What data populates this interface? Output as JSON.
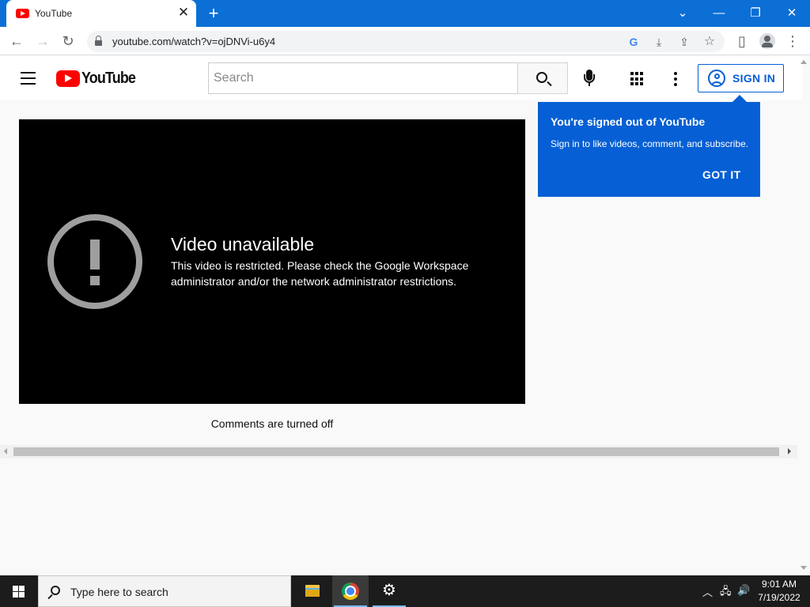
{
  "browser": {
    "tab_title": "YouTube",
    "tab_close": "✕",
    "new_tab": "+",
    "url": "youtube.com/watch?v=ojDNVi-u6y4",
    "window_controls": {
      "dropdown": "⌄",
      "minimize": "—",
      "restore": "❐",
      "close": "✕"
    },
    "nav": {
      "back": "←",
      "forward": "→",
      "reload": "↻"
    },
    "toolbar_icons": {
      "google": "G",
      "install": "⤓",
      "share": "⇪",
      "bookmark": "☆",
      "sidepanel": "▯",
      "menu": "⋮"
    }
  },
  "youtube": {
    "logo_text": "YouTube",
    "search_placeholder": "Search",
    "sign_in_label": "SIGN IN",
    "accent_color": "#065fd4",
    "brand_red": "#ff0000"
  },
  "player": {
    "error_title": "Video unavailable",
    "error_message": "This video is restricted. Please check the Google Workspace administrator and/or the network administrator restrictions."
  },
  "comments_status": "Comments are turned off",
  "tooltip": {
    "title": "You're signed out of YouTube",
    "body": "Sign in to like videos, comment, and subscribe.",
    "button": "GOT IT"
  },
  "taskbar": {
    "search_placeholder": "Type here to search",
    "time": "9:01 AM",
    "date": "7/19/2022",
    "tray": {
      "chevron": "︿",
      "network": "🖧",
      "volume": "🔊"
    },
    "settings_glyph": "⚙"
  }
}
